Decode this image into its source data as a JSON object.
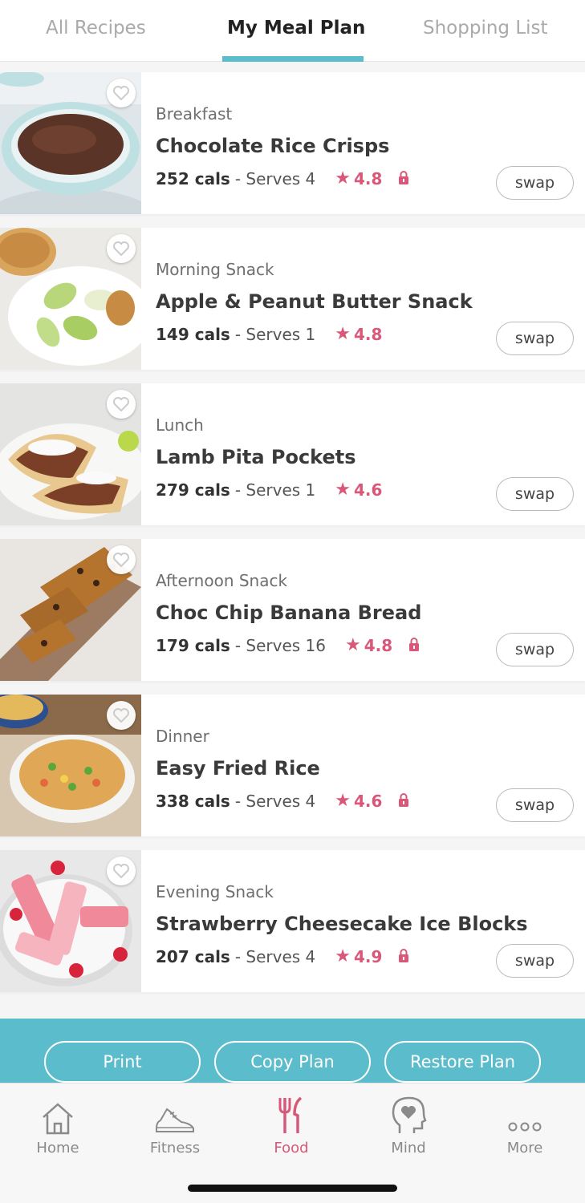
{
  "tabs": {
    "all_recipes": "All Recipes",
    "my_meal_plan": "My Meal Plan",
    "shopping_list": "Shopping List",
    "active": "My Meal Plan"
  },
  "meals": [
    {
      "type": "Breakfast",
      "name": "Chocolate Rice Crisps",
      "cals": "252 cals",
      "serves": "- Serves 4",
      "rating": "4.8",
      "locked": true,
      "swap": "swap"
    },
    {
      "type": "Morning Snack",
      "name": "Apple & Peanut Butter Snack",
      "cals": "149 cals",
      "serves": "- Serves 1",
      "rating": "4.8",
      "locked": false,
      "swap": "swap"
    },
    {
      "type": "Lunch",
      "name": "Lamb Pita Pockets",
      "cals": "279 cals",
      "serves": "- Serves 1",
      "rating": "4.6",
      "locked": false,
      "swap": "swap"
    },
    {
      "type": "Afternoon Snack",
      "name": "Choc Chip Banana Bread",
      "cals": "179 cals",
      "serves": "- Serves 16",
      "rating": "4.8",
      "locked": true,
      "swap": "swap"
    },
    {
      "type": "Dinner",
      "name": "Easy Fried Rice",
      "cals": "338 cals",
      "serves": "- Serves 4",
      "rating": "4.6",
      "locked": true,
      "swap": "swap"
    },
    {
      "type": "Evening Snack",
      "name": "Strawberry Cheesecake Ice Blocks",
      "cals": "207 cals",
      "serves": "- Serves 4",
      "rating": "4.9",
      "locked": true,
      "swap": "swap"
    }
  ],
  "actions": {
    "print": "Print",
    "copy_plan": "Copy Plan",
    "restore_plan": "Restore Plan"
  },
  "nav": {
    "home": "Home",
    "fitness": "Fitness",
    "food": "Food",
    "mind": "Mind",
    "more": "More",
    "active": "Food"
  },
  "colors": {
    "accent": "#5bbccc",
    "rating": "#d9587a",
    "active_nav": "#d9587a"
  },
  "icons": {
    "heart": "heart-icon",
    "star": "star-icon",
    "lock": "lock-icon",
    "home": "home-icon",
    "fitness": "sneaker-icon",
    "food": "fork-knife-icon",
    "mind": "head-heart-icon",
    "more": "dots-icon"
  }
}
